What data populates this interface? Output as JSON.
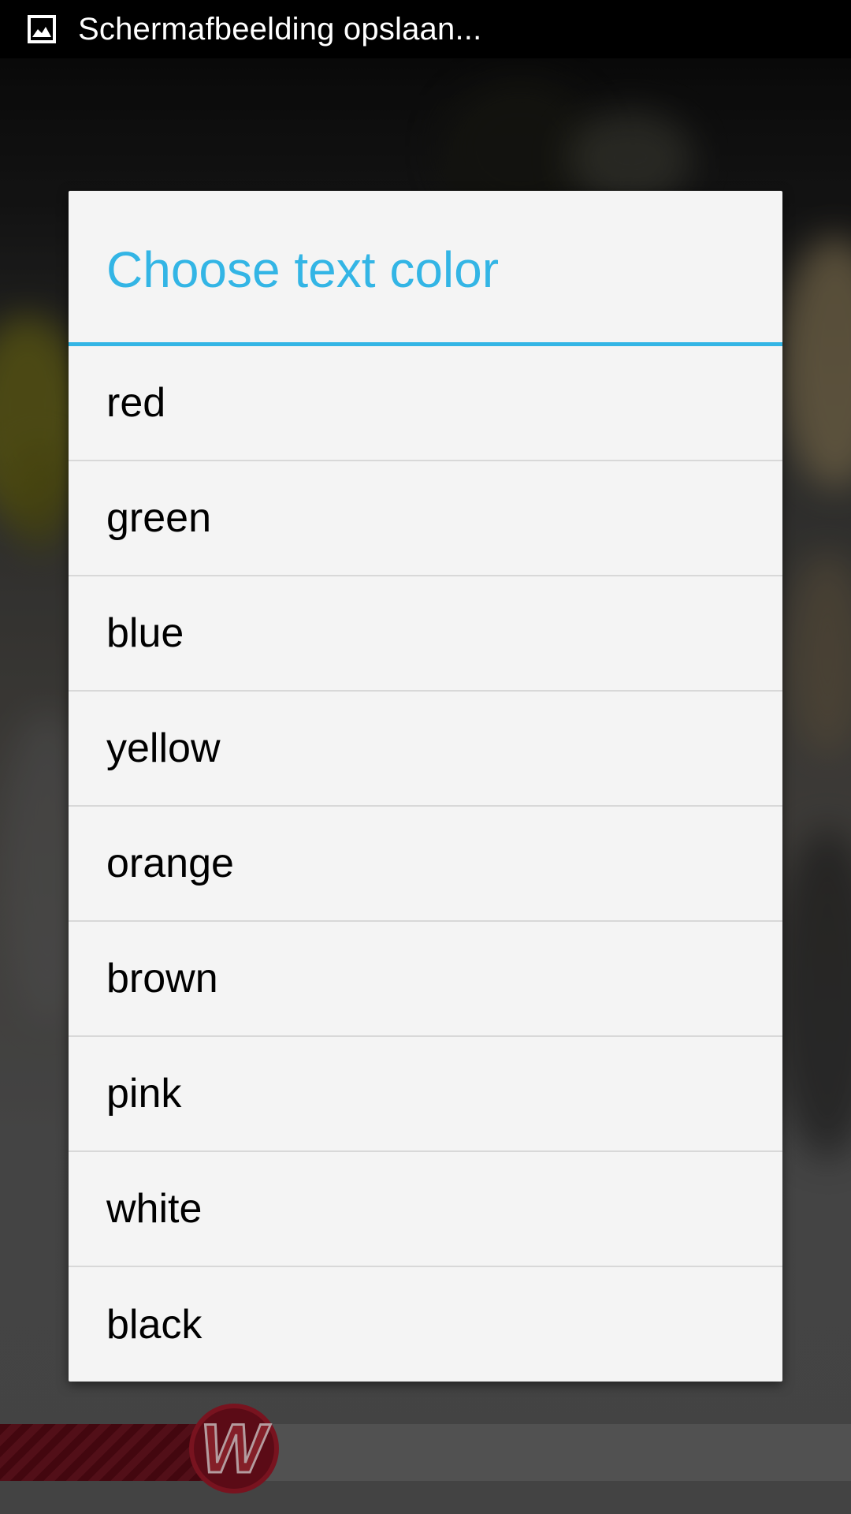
{
  "status_bar": {
    "notification_text": "Schermafbeelding opslaan...",
    "icon": "screenshot-image-icon"
  },
  "dialog": {
    "title": "Choose text color",
    "accent_color": "#33b5e5",
    "options": [
      {
        "label": "red"
      },
      {
        "label": "green"
      },
      {
        "label": "blue"
      },
      {
        "label": "yellow"
      },
      {
        "label": "orange"
      },
      {
        "label": "brown"
      },
      {
        "label": "pink"
      },
      {
        "label": "white"
      },
      {
        "label": "black"
      }
    ]
  },
  "background": {
    "logo_letter": "W"
  }
}
